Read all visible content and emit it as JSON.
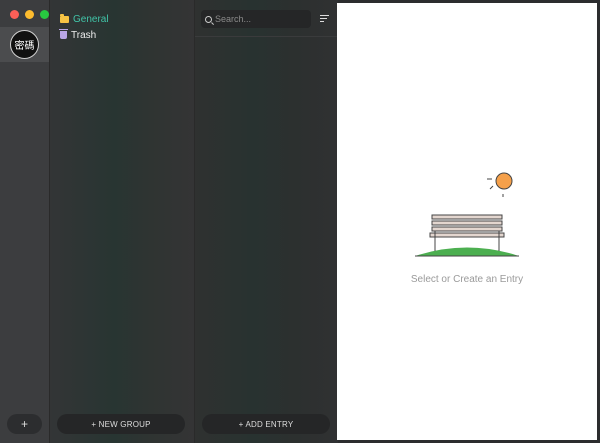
{
  "app": {
    "vault_label": "密碼"
  },
  "vaults": {
    "add_label": "+"
  },
  "groups": {
    "items": [
      {
        "label": "General",
        "icon": "folder-icon",
        "color": "#41c4a8"
      },
      {
        "label": "Trash",
        "icon": "trash-icon",
        "color": "#eeeeee"
      }
    ],
    "new_group_label": "+ NEW GROUP"
  },
  "entries": {
    "search_placeholder": "Search...",
    "sort_icon": "sort-icon",
    "add_entry_label": "+ ADD ENTRY"
  },
  "detail": {
    "empty_message": "Select or Create an Entry",
    "illustration": "park-bench-sun"
  },
  "colors": {
    "accent": "#41c4a8",
    "folder": "#f6c344",
    "trash": "#b9a6e6",
    "sun": "#f5a04a",
    "grass": "#4caf50"
  }
}
